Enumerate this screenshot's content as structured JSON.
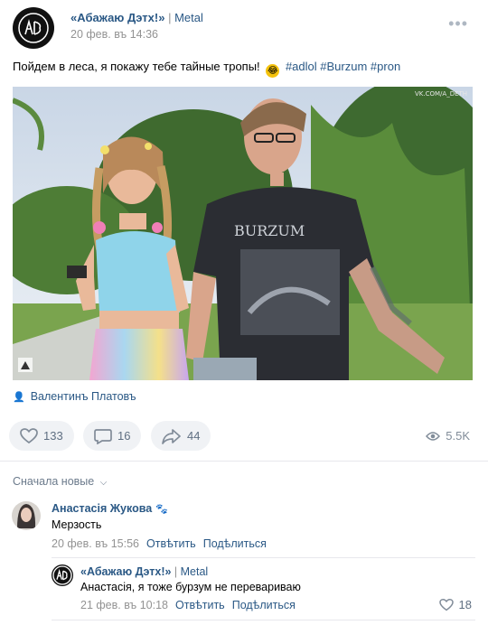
{
  "post": {
    "author_name": "«Абажаю Дэтх!»",
    "separator": " | ",
    "category": "Metal",
    "date": "20 фев. въ 14:36",
    "more": "•••",
    "text_main": "Пойдем в леса, я покажу тебе тайные тропы!",
    "tags": [
      "#adlol",
      "#Burzum",
      "#pron"
    ],
    "photo_watermark": "VK.COM/A_DETH",
    "shirt_text": "BURZUM",
    "signer": "Валентинъ Платовъ"
  },
  "actions": {
    "likes": "133",
    "comments": "16",
    "shares": "44",
    "views": "5.5K"
  },
  "comments_sort": "Сначала новые",
  "comments": [
    {
      "name": "Анастасія Жукова",
      "text": "Мерзость",
      "date": "20 фев. въ 15:56",
      "reply": "Отвѣтить",
      "share": "Подѣлиться"
    },
    {
      "name": "«Абажаю Дэтх!»",
      "separator": " | ",
      "category": "Metal",
      "text": "Анастасія, я тоже бурзум не перевариваю",
      "date": "21 фев. въ 10:18",
      "reply": "Отвѣтить",
      "share": "Подѣлиться",
      "likes": "18"
    }
  ],
  "colors": {
    "link": "#2a5885",
    "muted": "#939393",
    "pill_bg": "#f0f2f5"
  }
}
